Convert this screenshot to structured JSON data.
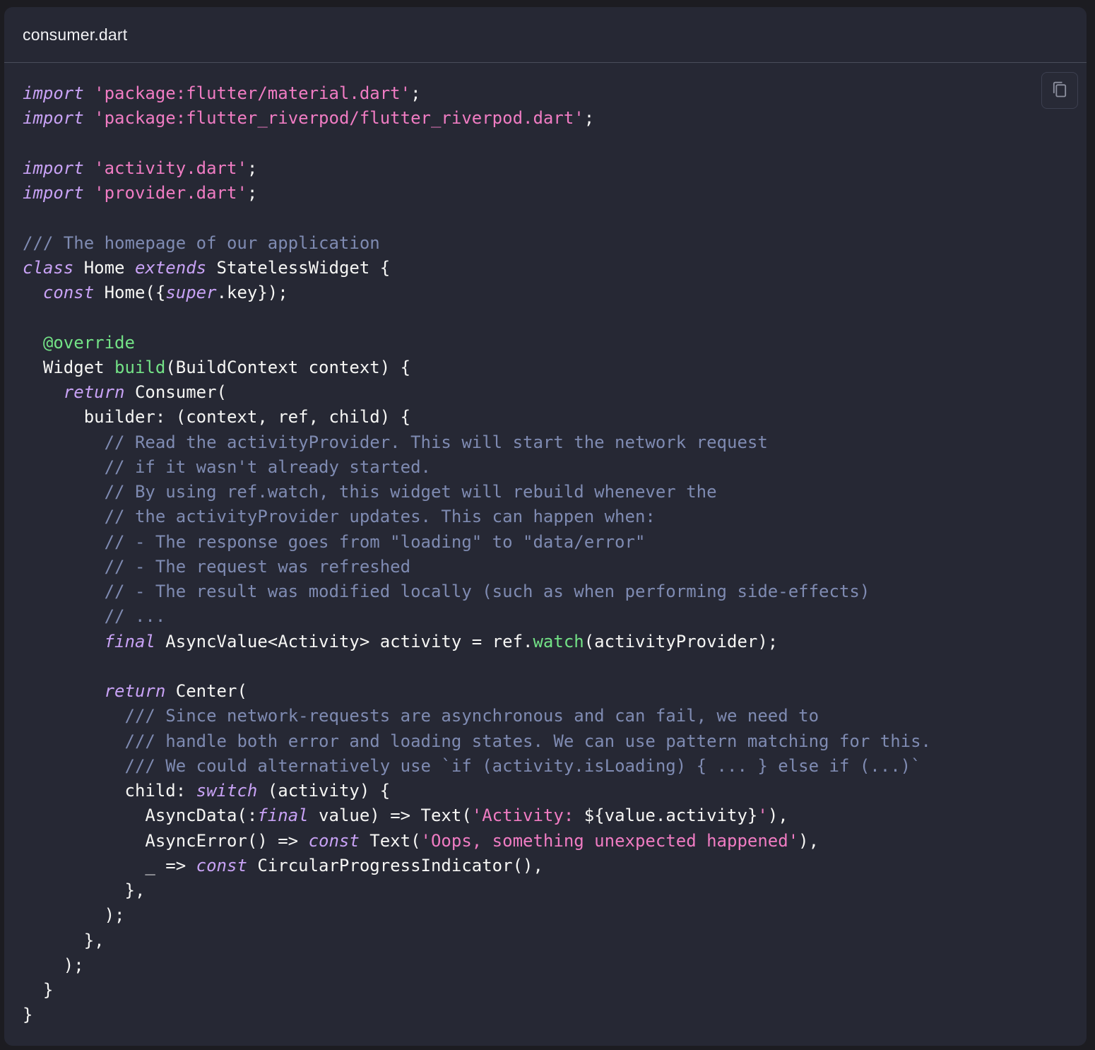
{
  "file": {
    "name": "consumer.dart"
  },
  "toolbar": {
    "copy_icon": "copy-icon"
  },
  "colors": {
    "card_background": "#262834",
    "keyword": "#c8a2f5",
    "string": "#f07cc3",
    "comment": "#7f8bb2",
    "function": "#73e286",
    "plain": "#f6f6f4"
  },
  "code": {
    "lines": [
      [
        [
          "kw",
          "import"
        ],
        [
          "pl",
          " "
        ],
        [
          "str",
          "'package:flutter/material.dart'"
        ],
        [
          "pl",
          ";"
        ]
      ],
      [
        [
          "kw",
          "import"
        ],
        [
          "pl",
          " "
        ],
        [
          "str",
          "'package:flutter_riverpod/flutter_riverpod.dart'"
        ],
        [
          "pl",
          ";"
        ]
      ],
      [],
      [
        [
          "kw",
          "import"
        ],
        [
          "pl",
          " "
        ],
        [
          "str",
          "'activity.dart'"
        ],
        [
          "pl",
          ";"
        ]
      ],
      [
        [
          "kw",
          "import"
        ],
        [
          "pl",
          " "
        ],
        [
          "str",
          "'provider.dart'"
        ],
        [
          "pl",
          ";"
        ]
      ],
      [],
      [
        [
          "cm",
          "/// The homepage of our application"
        ]
      ],
      [
        [
          "kw",
          "class"
        ],
        [
          "pl",
          " Home "
        ],
        [
          "kw",
          "extends"
        ],
        [
          "pl",
          " StatelessWidget {"
        ]
      ],
      [
        [
          "pl",
          "  "
        ],
        [
          "kw",
          "const"
        ],
        [
          "pl",
          " Home({"
        ],
        [
          "kw",
          "super"
        ],
        [
          "pl",
          ".key});"
        ]
      ],
      [],
      [
        [
          "pl",
          "  "
        ],
        [
          "fn",
          "@override"
        ]
      ],
      [
        [
          "pl",
          "  Widget "
        ],
        [
          "fn",
          "build"
        ],
        [
          "pl",
          "(BuildContext context) {"
        ]
      ],
      [
        [
          "pl",
          "    "
        ],
        [
          "kw",
          "return"
        ],
        [
          "pl",
          " Consumer("
        ]
      ],
      [
        [
          "pl",
          "      builder: (context, ref, child) {"
        ]
      ],
      [
        [
          "pl",
          "        "
        ],
        [
          "cm",
          "// Read the activityProvider. This will start the network request"
        ]
      ],
      [
        [
          "pl",
          "        "
        ],
        [
          "cm",
          "// if it wasn't already started."
        ]
      ],
      [
        [
          "pl",
          "        "
        ],
        [
          "cm",
          "// By using ref.watch, this widget will rebuild whenever the"
        ]
      ],
      [
        [
          "pl",
          "        "
        ],
        [
          "cm",
          "// the activityProvider updates. This can happen when:"
        ]
      ],
      [
        [
          "pl",
          "        "
        ],
        [
          "cm",
          "// - The response goes from \"loading\" to \"data/error\""
        ]
      ],
      [
        [
          "pl",
          "        "
        ],
        [
          "cm",
          "// - The request was refreshed"
        ]
      ],
      [
        [
          "pl",
          "        "
        ],
        [
          "cm",
          "// - The result was modified locally (such as when performing side-effects)"
        ]
      ],
      [
        [
          "pl",
          "        "
        ],
        [
          "cm",
          "// ..."
        ]
      ],
      [
        [
          "pl",
          "        "
        ],
        [
          "kw",
          "final"
        ],
        [
          "pl",
          " AsyncValue<Activity> activity = ref."
        ],
        [
          "fn",
          "watch"
        ],
        [
          "pl",
          "(activityProvider);"
        ]
      ],
      [],
      [
        [
          "pl",
          "        "
        ],
        [
          "kw",
          "return"
        ],
        [
          "pl",
          " Center("
        ]
      ],
      [
        [
          "pl",
          "          "
        ],
        [
          "cm",
          "/// Since network-requests are asynchronous and can fail, we need to"
        ]
      ],
      [
        [
          "pl",
          "          "
        ],
        [
          "cm",
          "/// handle both error and loading states. We can use pattern matching for this."
        ]
      ],
      [
        [
          "pl",
          "          "
        ],
        [
          "cm",
          "/// We could alternatively use `if (activity.isLoading) { ... } else if (...)`"
        ]
      ],
      [
        [
          "pl",
          "          child: "
        ],
        [
          "kw",
          "switch"
        ],
        [
          "pl",
          " (activity) {"
        ]
      ],
      [
        [
          "pl",
          "            AsyncData(:"
        ],
        [
          "kw",
          "final"
        ],
        [
          "pl",
          " value) => Text("
        ],
        [
          "str",
          "'Activity: "
        ],
        [
          "pl",
          "${value.activity}"
        ],
        [
          "str",
          "'"
        ],
        [
          "pl",
          "),"
        ]
      ],
      [
        [
          "pl",
          "            AsyncError() => "
        ],
        [
          "kw",
          "const"
        ],
        [
          "pl",
          " Text("
        ],
        [
          "str",
          "'Oops, something unexpected happened'"
        ],
        [
          "pl",
          "),"
        ]
      ],
      [
        [
          "pl",
          "            _ => "
        ],
        [
          "kw",
          "const"
        ],
        [
          "pl",
          " CircularProgressIndicator(),"
        ]
      ],
      [
        [
          "pl",
          "          },"
        ]
      ],
      [
        [
          "pl",
          "        );"
        ]
      ],
      [
        [
          "pl",
          "      },"
        ]
      ],
      [
        [
          "pl",
          "    );"
        ]
      ],
      [
        [
          "pl",
          "  }"
        ]
      ],
      [
        [
          "pl",
          "}"
        ]
      ]
    ]
  }
}
